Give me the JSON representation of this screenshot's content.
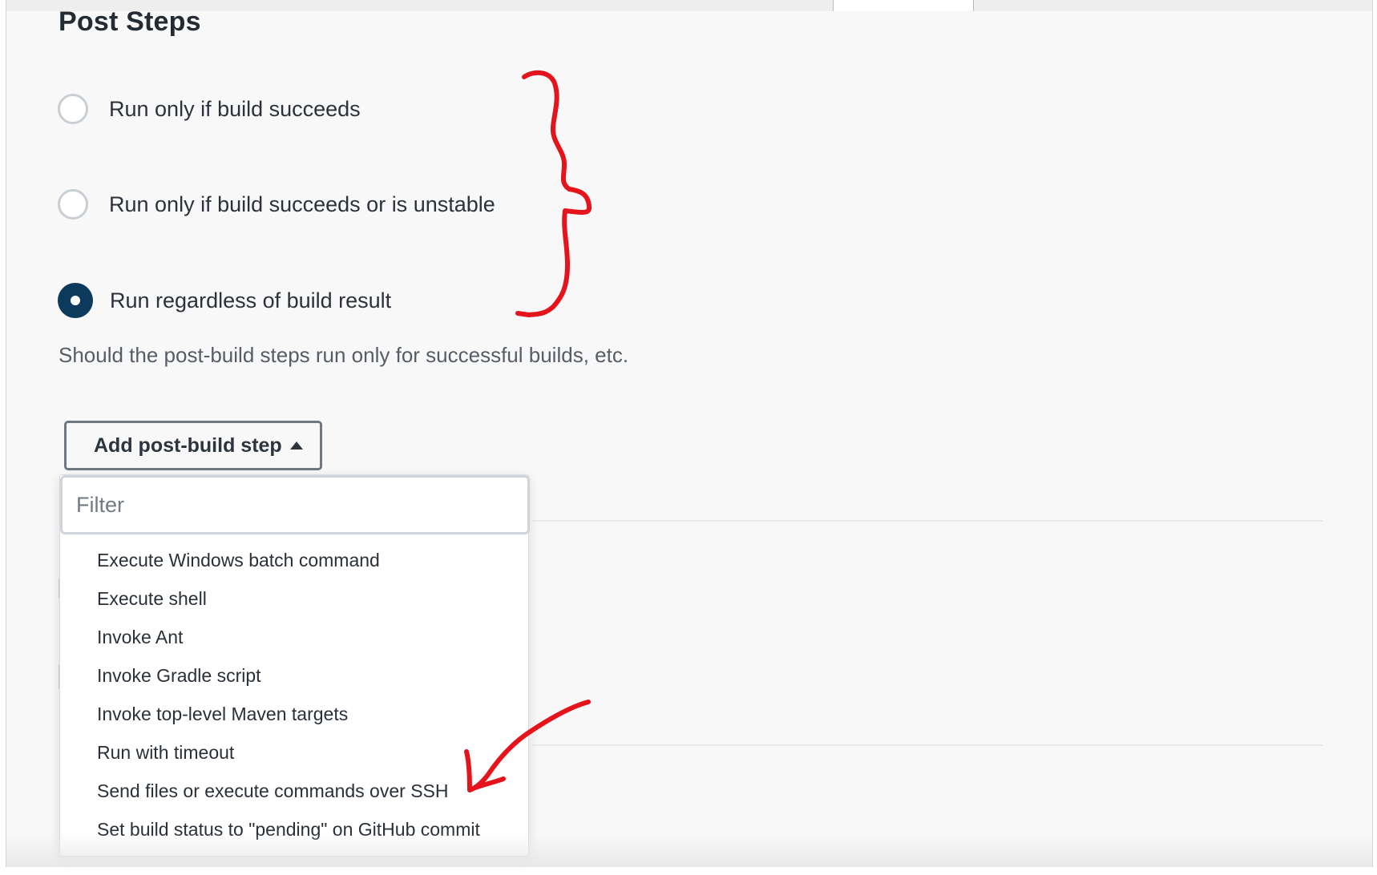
{
  "section": {
    "title": "Post Steps"
  },
  "options": [
    {
      "label": "Run only if build succeeds",
      "selected": false
    },
    {
      "label": "Run only if build succeeds or is unstable",
      "selected": false
    },
    {
      "label": "Run regardless of build result",
      "selected": true
    }
  ],
  "help_text": "Should the post-build steps run only for successful builds, etc.",
  "add_button": {
    "label": "Add post-build step",
    "icon": "caret-up-icon"
  },
  "dropdown": {
    "filter_placeholder": "Filter",
    "items": [
      "Execute Windows batch command",
      "Execute shell",
      "Invoke Ant",
      "Invoke Gradle script",
      "Invoke top-level Maven targets",
      "Run with timeout",
      "Send files or execute commands over SSH",
      "Set build status to \"pending\" on GitHub commit"
    ]
  },
  "colors": {
    "accent": "#0c3a5c",
    "annotation": "#e5141c"
  }
}
